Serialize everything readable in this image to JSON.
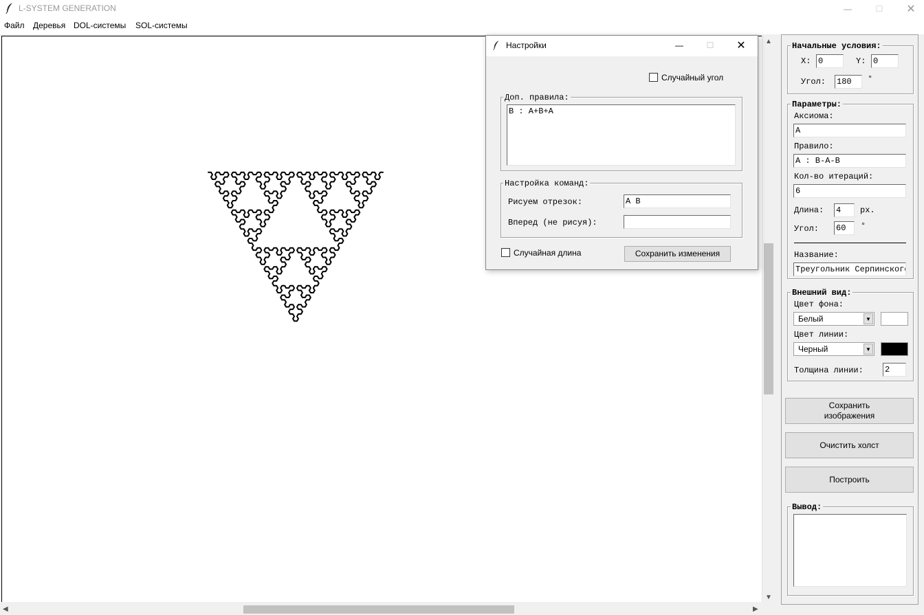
{
  "window": {
    "title": "L-SYSTEM GENERATION",
    "controls": {
      "minimize": "—",
      "maximize": "☐",
      "close": "✕"
    }
  },
  "menu": [
    "Файл",
    "Деревья",
    "DOL-системы",
    "SOL-системы"
  ],
  "panel": {
    "initial": {
      "title": "Начальные условия:",
      "x_label": "X:",
      "x_value": "0",
      "y_label": "Y:",
      "y_value": "0",
      "angle_label": "Угол:",
      "angle_value": "180",
      "angle_unit": "°"
    },
    "params": {
      "title": "Параметры:",
      "axiom_label": "Аксиома:",
      "axiom_value": "A",
      "rule_label": "Правило:",
      "rule_value": "A : B-A-B",
      "iter_label": "Кол-во итераций:",
      "iter_value": "6",
      "length_label": "Длина:",
      "length_value": "4",
      "length_unit": "px.",
      "angle_label": "Угол:",
      "angle_value": "60",
      "angle_unit": "°",
      "name_label": "Название:",
      "name_value": "Треугольник Серпинского"
    },
    "appearance": {
      "title": "Внешний вид:",
      "bg_label": "Цвет фона:",
      "bg_value": "Белый",
      "bg_color": "#ffffff",
      "line_label": "Цвет линии:",
      "line_value": "Черный",
      "line_color": "#000000",
      "width_label": "Толщина линии:",
      "width_value": "2"
    },
    "buttons": {
      "save_image": "Сохранить\nизображения",
      "clear": "Очистить холст",
      "build": "Построить"
    },
    "output": {
      "title": "Вывод:",
      "value": ""
    }
  },
  "dialog": {
    "title": "Настройки",
    "random_angle": "Случайный угол",
    "extra_rules": {
      "title": "Доп. правила:",
      "value": "B : A+B+A"
    },
    "commands": {
      "title": "Настройка команд:",
      "draw_label": "Рисуем отрезок:",
      "draw_value": "A B",
      "move_label": "Вперед (не рисуя):",
      "move_value": ""
    },
    "random_length": "Случайная длина",
    "save_button": "Сохранить изменения"
  },
  "fractal": {
    "axiom": "A",
    "rules": {
      "A": "B-A-B",
      "B": "A+B+A"
    },
    "iterations": 6,
    "angle_deg": 60,
    "start_angle_deg": 180,
    "line_color": "#000000",
    "line_width": 2
  }
}
